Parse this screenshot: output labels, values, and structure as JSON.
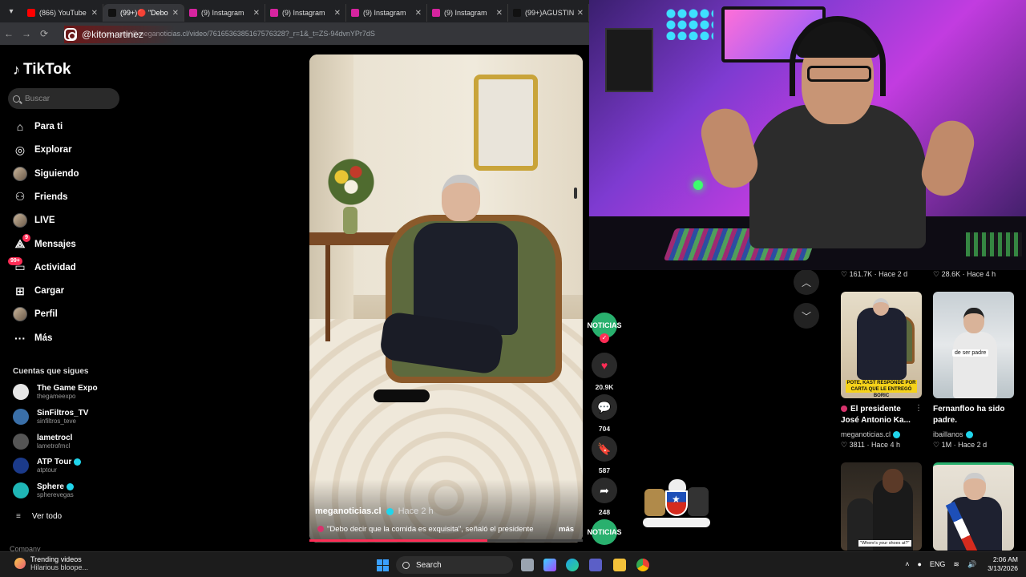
{
  "browser": {
    "tabs": [
      {
        "label": "(866) YouTube",
        "color": "#ff0000",
        "active": false
      },
      {
        "label": "(99+)🔴 \"Debo",
        "color": "#111111",
        "active": true
      },
      {
        "label": "(9) Instagram",
        "color": "#d6249f",
        "active": false
      },
      {
        "label": "(9) Instagram",
        "color": "#d6249f",
        "active": false
      },
      {
        "label": "(9) Instagram",
        "color": "#d6249f",
        "active": false
      },
      {
        "label": "(9) Instagram",
        "color": "#d6249f",
        "active": false
      },
      {
        "label": "(99+)AGUSTIN",
        "color": "#111111",
        "active": false
      }
    ],
    "url": "tiktok.com/@meganoticias.cl/video/7616536385167576328?_r=1&_t=ZS-94dvnYPr7dS",
    "overlay_handle": "@kitomartinez"
  },
  "sidebar": {
    "logo": "TikTok",
    "search_placeholder": "Buscar",
    "nav": [
      {
        "label": "Para ti",
        "icon": "home-icon"
      },
      {
        "label": "Explorar",
        "icon": "compass-icon"
      },
      {
        "label": "Siguiendo",
        "icon": "avatar-icon"
      },
      {
        "label": "Friends",
        "icon": "friends-icon"
      },
      {
        "label": "LIVE",
        "icon": "live-icon"
      },
      {
        "label": "Mensajes",
        "icon": "message-icon",
        "badge": "9"
      },
      {
        "label": "Actividad",
        "icon": "activity-icon",
        "badge": "99+"
      },
      {
        "label": "Cargar",
        "icon": "upload-icon"
      },
      {
        "label": "Perfil",
        "icon": "profile-icon"
      },
      {
        "label": "Más",
        "icon": "more-icon"
      }
    ],
    "following_title": "Cuentas que sigues",
    "following": [
      {
        "name": "The Game Expo",
        "handle": "thegameexpo",
        "color": "#e6e6e6",
        "verified": false
      },
      {
        "name": "SinFiltros_TV",
        "handle": "sinfiltros_teve",
        "color": "#3a6fa8",
        "verified": false
      },
      {
        "name": "lametrocl",
        "handle": "lametrofmcl",
        "color": "#555555",
        "verified": false
      },
      {
        "name": "ATP Tour",
        "handle": "atptour",
        "color": "#1b3a8a",
        "verified": true
      },
      {
        "name": "Sphere",
        "handle": "spherevegas",
        "color": "#1fb6b6",
        "verified": true
      }
    ],
    "see_all": "Ver todo",
    "company": "Company"
  },
  "video": {
    "author": "meganoticias.cl",
    "time": "Hace 2 h",
    "caption": "\"Debo decir que la comida es exquisita\", señaló el presidente",
    "more": "más",
    "progress": 0.65
  },
  "actions": {
    "likes": "20.9K",
    "comments": "704",
    "saves": "587",
    "shares": "248",
    "account_badge": "NOTICIAS"
  },
  "recommendations": {
    "top_stats": [
      {
        "likes": "161.7K",
        "time": "Hace 2 d"
      },
      {
        "likes": "28.6K",
        "time": "Hace 4 h"
      }
    ],
    "cards": [
      {
        "title": "El presidente José Antonio Ka...",
        "author": "meganoticias.cl",
        "likes": "3811",
        "time": "Hace 4 h",
        "banner": "POTE, KAST RESPONDE POR CARTA QUE LE ENTREGÓ BORIC",
        "live": true
      },
      {
        "title": "Fernanfloo ha sido padre.",
        "author": "ibaillanos",
        "likes": "1M",
        "time": "Hace 2 d",
        "caption": "de ser padre",
        "live": false
      }
    ],
    "card3_caption": "\"Where's your shoes at?\""
  },
  "taskbar": {
    "trending_title": "Trending videos",
    "trending_sub": "Hilarious bloope...",
    "search": "Search",
    "lang": "ENG",
    "time": "2:06 AM",
    "date": "3/13/2026"
  }
}
